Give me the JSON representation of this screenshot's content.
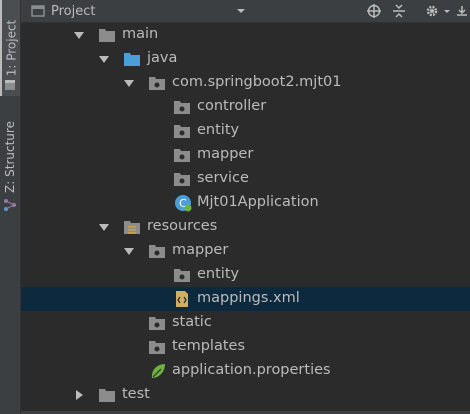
{
  "header": {
    "title": "Project"
  },
  "sidebar": {
    "project_tab": "1: Project",
    "structure_tab": "Z: Structure"
  },
  "tree": {
    "main": "main",
    "java": "java",
    "package": "com.springboot2.mjt01",
    "controller": "controller",
    "entity": "entity",
    "mapper": "mapper",
    "service": "service",
    "app_class": "Mjt01Application",
    "resources": "resources",
    "res_mapper": "mapper",
    "res_mapper_entity": "entity",
    "mappings": "mappings.xml",
    "static": "static",
    "templates": "templates",
    "app_props": "application.properties",
    "test": "test"
  },
  "icons": {
    "header": [
      "project-icon",
      "chevron-down-icon",
      "crosshair-icon",
      "collapse-icon",
      "gear-icon",
      "hide-icon"
    ],
    "tree": [
      "folder-icon",
      "source-folder-icon",
      "package-icon",
      "spring-boot-icon",
      "resources-folder-icon",
      "xml-file-icon",
      "spring-leaf-icon"
    ]
  },
  "colors": {
    "background": "#2b2b2b",
    "panel": "#3c3f41",
    "selection": "#0d293e",
    "text": "#bbbbbb",
    "source_folder": "#4a9fd8",
    "spring": "#6db33f"
  }
}
